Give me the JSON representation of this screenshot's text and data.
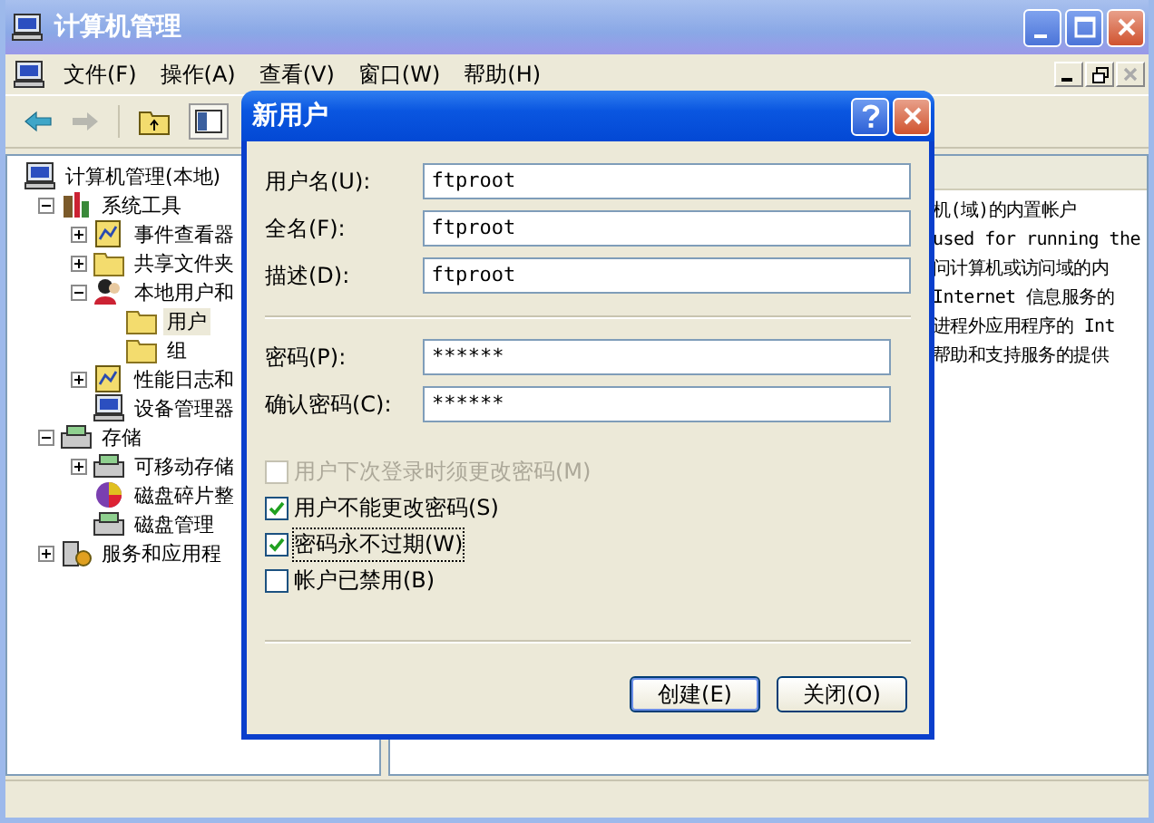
{
  "window": {
    "title": "计算机管理"
  },
  "menu": [
    {
      "label": "文件(F)"
    },
    {
      "label": "操作(A)"
    },
    {
      "label": "查看(V)"
    },
    {
      "label": "窗口(W)"
    },
    {
      "label": "帮助(H)"
    }
  ],
  "tree": {
    "items": [
      {
        "label": "计算机管理(本地)",
        "selected": false,
        "children": [
          {
            "label": "系统工具",
            "selected": false,
            "expanded": true,
            "children": [
              {
                "label": "事件查看器",
                "selected": false,
                "expanded": false
              },
              {
                "label": "共享文件夹",
                "selected": false,
                "expanded": false
              },
              {
                "label": "本地用户和",
                "selected": false,
                "expanded": true,
                "children": [
                  {
                    "label": "用户",
                    "selected": true
                  },
                  {
                    "label": "组",
                    "selected": false
                  }
                ]
              },
              {
                "label": "性能日志和",
                "selected": false,
                "expanded": false
              },
              {
                "label": "设备管理器",
                "selected": false
              }
            ]
          },
          {
            "label": "存储",
            "selected": false,
            "expanded": true,
            "children": [
              {
                "label": "可移动存储",
                "selected": false,
                "expanded": false
              },
              {
                "label": "磁盘碎片整",
                "selected": false
              },
              {
                "label": "磁盘管理",
                "selected": false
              }
            ]
          },
          {
            "label": "服务和应用程",
            "selected": false,
            "expanded": false
          }
        ]
      }
    ]
  },
  "list": {
    "rows": [
      "机(域)的内置帐户",
      "used for running the",
      "问计算机或访问域的内",
      "Internet 信息服务的",
      "进程外应用程序的 Int",
      "帮助和支持服务的提供"
    ]
  },
  "dialog": {
    "title": "新用户",
    "fields": [
      {
        "label": "用户名(U):",
        "value": "ftproot",
        "kind": "wide"
      },
      {
        "label": "全名(F):",
        "value": "ftproot",
        "kind": "wide"
      },
      {
        "label": "描述(D):",
        "value": "ftproot",
        "kind": "wide"
      },
      {
        "label": "密码(P):",
        "value": "******",
        "kind": "narrow"
      },
      {
        "label": "确认密码(C):",
        "value": "******",
        "kind": "narrow"
      }
    ],
    "checkboxes": [
      {
        "label": "用户下次登录时须更改密码(M)",
        "checked": false,
        "disabled": true,
        "focused": false
      },
      {
        "label": "用户不能更改密码(S)",
        "checked": true,
        "disabled": false,
        "focused": false
      },
      {
        "label": "密码永不过期(W)",
        "checked": true,
        "disabled": false,
        "focused": true
      },
      {
        "label": "帐户已禁用(B)",
        "checked": false,
        "disabled": false,
        "focused": false
      }
    ],
    "buttons": [
      "创建(E)",
      "关闭(O)"
    ]
  }
}
